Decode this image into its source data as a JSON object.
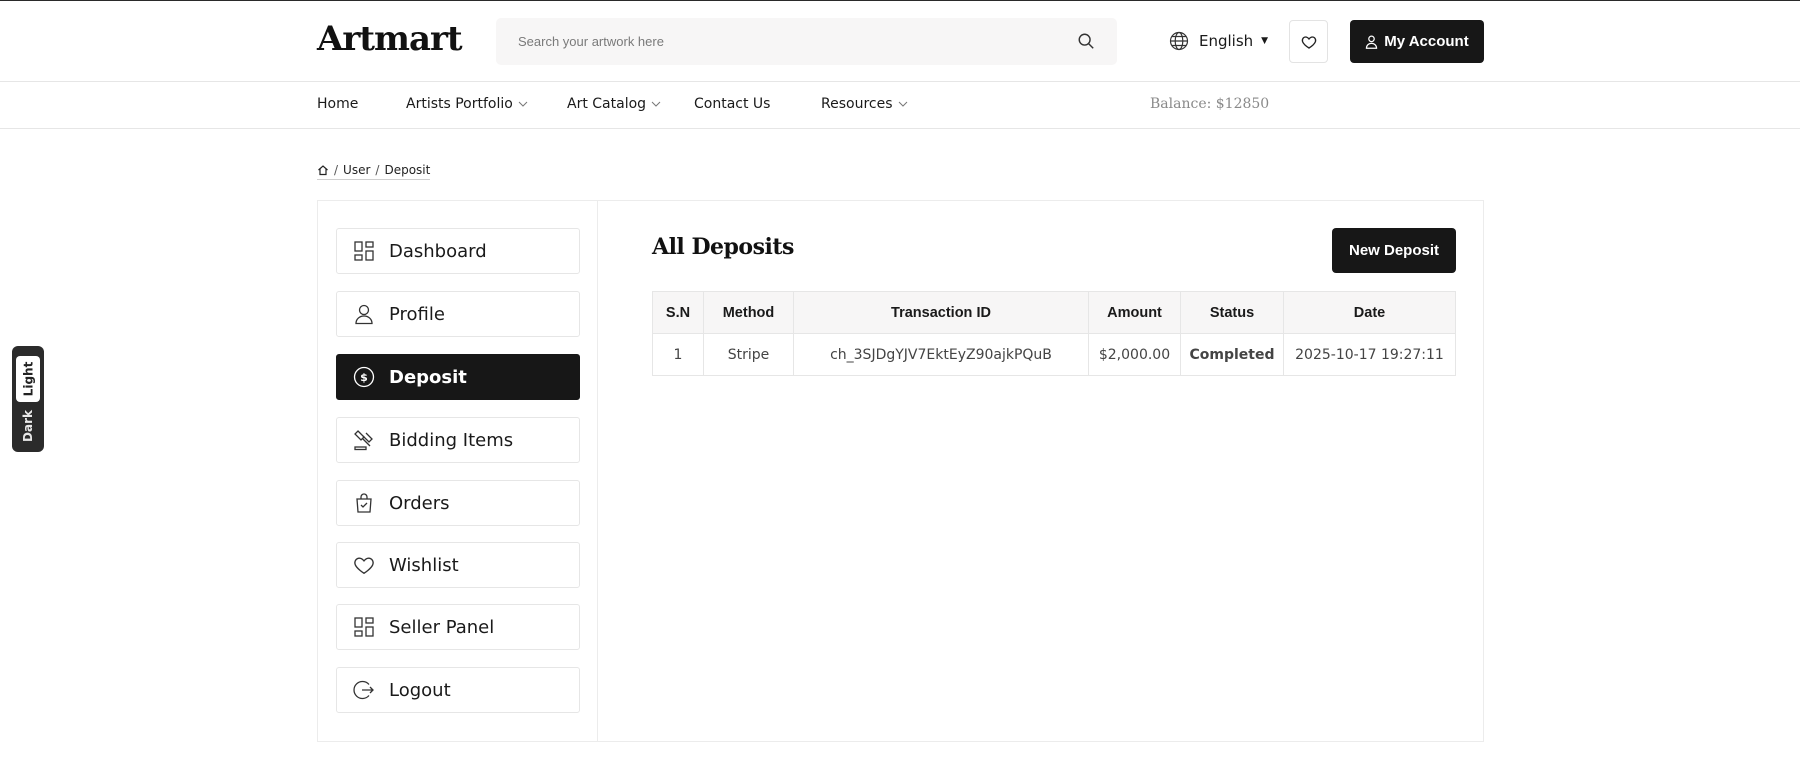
{
  "header": {
    "logo": "Artmart",
    "search_placeholder": "Search your artwork here",
    "language": "English",
    "account_label": "My Account"
  },
  "nav": {
    "items": [
      "Home",
      "Artists Portfolio",
      "Art Catalog",
      "Contact Us",
      "Resources"
    ],
    "balance": "Balance: $12850"
  },
  "breadcrumb": {
    "items": [
      "User",
      "Deposit"
    ]
  },
  "sidebar": {
    "items": [
      {
        "label": "Dashboard",
        "icon": "grid-icon"
      },
      {
        "label": "Profile",
        "icon": "user-icon"
      },
      {
        "label": "Deposit",
        "icon": "dollar-circle-icon",
        "active": true
      },
      {
        "label": "Bidding Items",
        "icon": "gavel-icon"
      },
      {
        "label": "Orders",
        "icon": "shopping-bag-icon"
      },
      {
        "label": "Wishlist",
        "icon": "heart-icon"
      },
      {
        "label": "Seller Panel",
        "icon": "grid-icon"
      },
      {
        "label": "Logout",
        "icon": "logout-icon"
      }
    ]
  },
  "main": {
    "title": "All Deposits",
    "new_deposit_label": "New Deposit",
    "table": {
      "headers": [
        "S.N",
        "Method",
        "Transaction ID",
        "Amount",
        "Status",
        "Date"
      ],
      "rows": [
        [
          "1",
          "Stripe",
          "ch_3SJDgYJV7EktEyZ90ajkPQuB",
          "$2,000.00",
          "Completed",
          "2025-10-17 19:27:11"
        ]
      ]
    }
  },
  "theme_toggle": {
    "light": "Light",
    "dark": "Dark"
  },
  "colors": {
    "primary": "#171717",
    "status_completed": "#2e9e5b",
    "balance_text": "#8a8a8a"
  }
}
